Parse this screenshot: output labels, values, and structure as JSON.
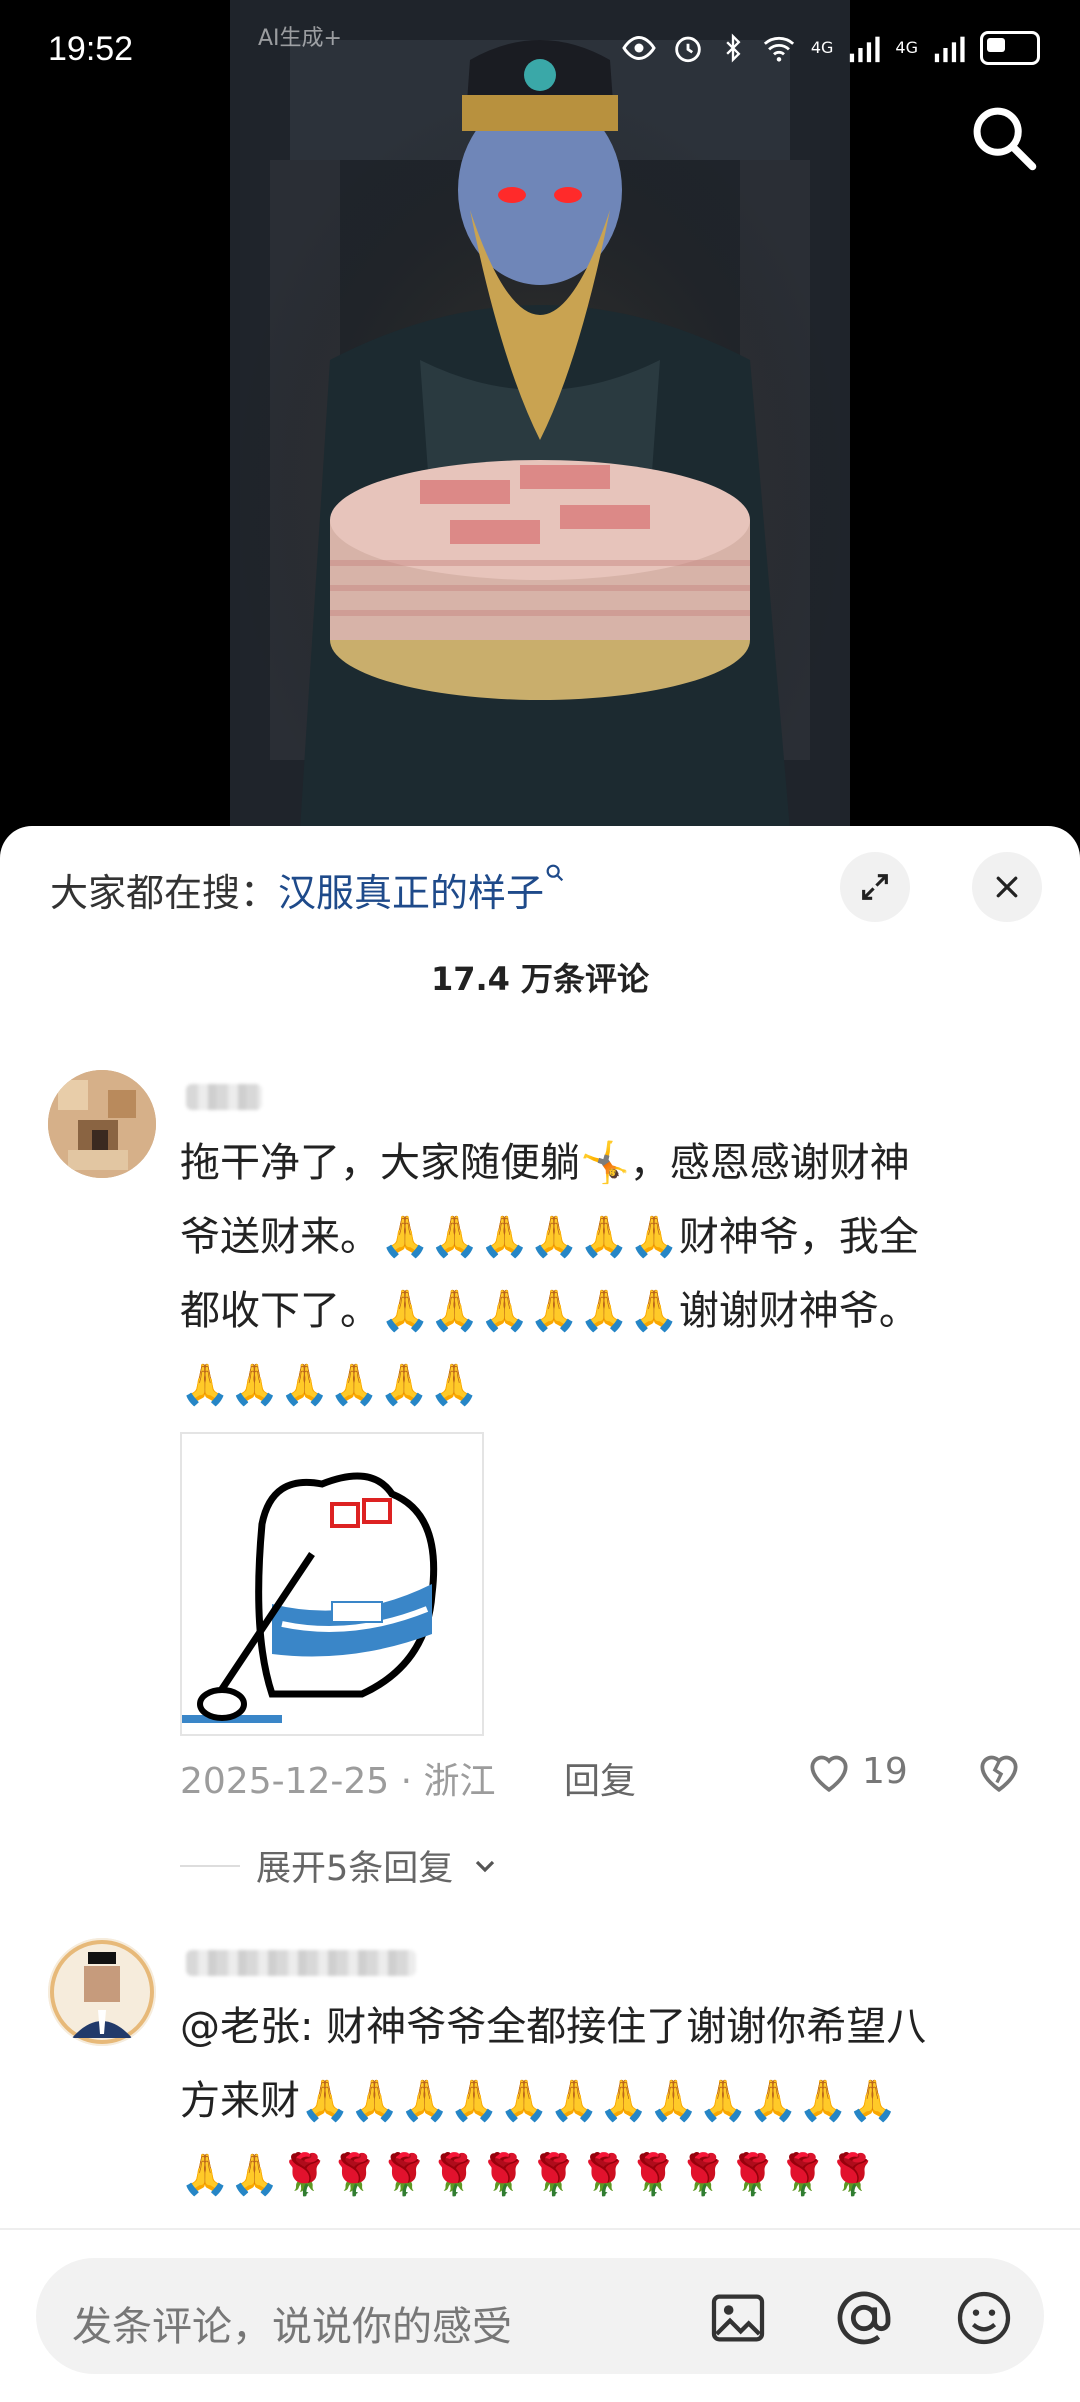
{
  "status_bar": {
    "time": "19:52",
    "signal_labels": [
      "4G",
      "4G"
    ]
  },
  "video": {
    "ai_tag": "AI生成+"
  },
  "comments_panel": {
    "trending_prefix": "大家都在搜：",
    "trending_keyword": "汉服真正的样子",
    "comment_count": "17.4 万条评论"
  },
  "comments": [
    {
      "text_lines": [
        "拖干净了，大家随便躺🤸，感恩感谢财神",
        "爷送财来。🙏🙏🙏🙏🙏🙏财神爷，我全",
        "都收下了。🙏🙏🙏🙏🙏🙏谢谢财神爷。",
        "🙏🙏🙏🙏🙏🙏"
      ],
      "date": "2025-12-25 · 浙江",
      "reply_label": "回复",
      "likes": "19",
      "expand_replies": "展开5条回复"
    },
    {
      "text_lines": [
        "@老张: 财神爷爷全都接住了谢谢你希望八",
        "方来财🙏🙏🙏🙏🙏🙏🙏🙏🙏🙏🙏🙏",
        "🙏🙏🌹🌹🌹🌹🌹🌹🌹🌹🌹🌹🌹🌹"
      ]
    }
  ],
  "input_bar": {
    "placeholder": "发条评论，说说你的感受"
  },
  "colors": {
    "keyword": "#1e4a8a",
    "accent_red": "#e0292f"
  },
  "icons": [
    "search-icon",
    "expand-icon",
    "close-icon",
    "heart-icon",
    "dislike-icon",
    "chevron-down-icon",
    "image-icon",
    "at-icon",
    "emoji-icon"
  ]
}
